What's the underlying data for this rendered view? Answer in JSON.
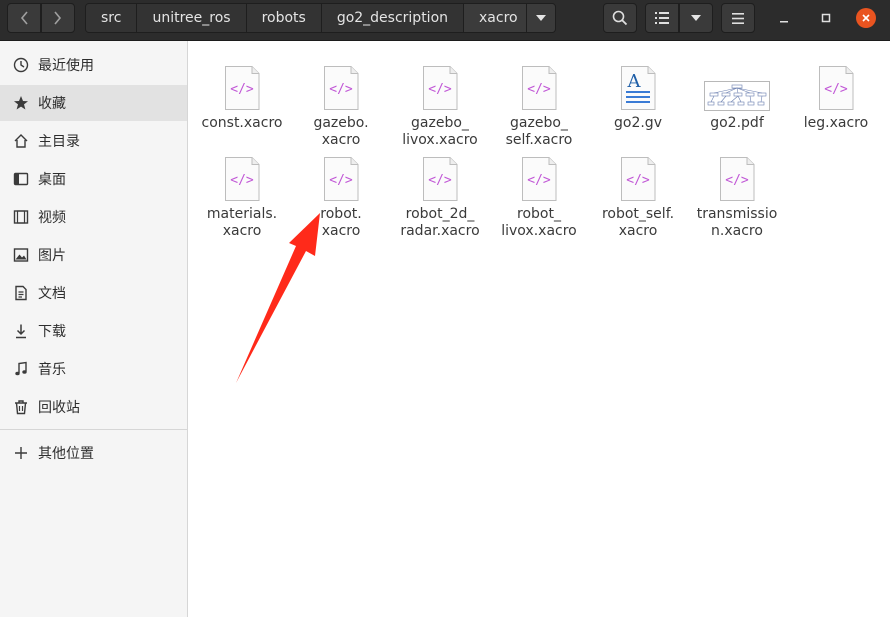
{
  "toolbar": {
    "back_icon": "chevron-left-icon",
    "forward_icon": "chevron-right-icon",
    "breadcrumbs": [
      "src",
      "unitree_ros",
      "robots",
      "go2_description",
      "xacro"
    ]
  },
  "sidebar": {
    "items": [
      {
        "label": "最近使用",
        "icon": "clock-icon"
      },
      {
        "label": "收藏",
        "icon": "star-icon"
      },
      {
        "label": "主目录",
        "icon": "home-icon"
      },
      {
        "label": "桌面",
        "icon": "desktop-icon"
      },
      {
        "label": "视频",
        "icon": "video-icon"
      },
      {
        "label": "图片",
        "icon": "image-icon"
      },
      {
        "label": "文档",
        "icon": "document-icon"
      },
      {
        "label": "下载",
        "icon": "download-icon"
      },
      {
        "label": "音乐",
        "icon": "music-icon"
      },
      {
        "label": "回收站",
        "icon": "trash-icon"
      }
    ],
    "other_locations": {
      "label": "其他位置",
      "icon": "plus-icon"
    }
  },
  "files": [
    {
      "name": "const.xacro",
      "type": "xacro"
    },
    {
      "name": "gazebo.\nxacro",
      "type": "xacro"
    },
    {
      "name": "gazebo_\nlivox.xacro",
      "type": "xacro"
    },
    {
      "name": "gazebo_\nself.xacro",
      "type": "xacro"
    },
    {
      "name": "go2.gv",
      "type": "gv"
    },
    {
      "name": "go2.pdf",
      "type": "pdf"
    },
    {
      "name": "leg.xacro",
      "type": "xacro"
    },
    {
      "name": "materials.\nxacro",
      "type": "xacro"
    },
    {
      "name": "robot.\nxacro",
      "type": "xacro"
    },
    {
      "name": "robot_2d_\nradar.xacro",
      "type": "xacro"
    },
    {
      "name": "robot_\nlivox.xacro",
      "type": "xacro"
    },
    {
      "name": "robot_self.\nxacro",
      "type": "xacro"
    },
    {
      "name": "transmissio\nn.xacro",
      "type": "xacro"
    }
  ],
  "colors": {
    "header": "#2c2c2c",
    "sidebar": "#f5f5f5",
    "accent_close": "#e95420",
    "annotation_arrow": "#ff2a1a",
    "xacro_tag": "#c157d6"
  }
}
